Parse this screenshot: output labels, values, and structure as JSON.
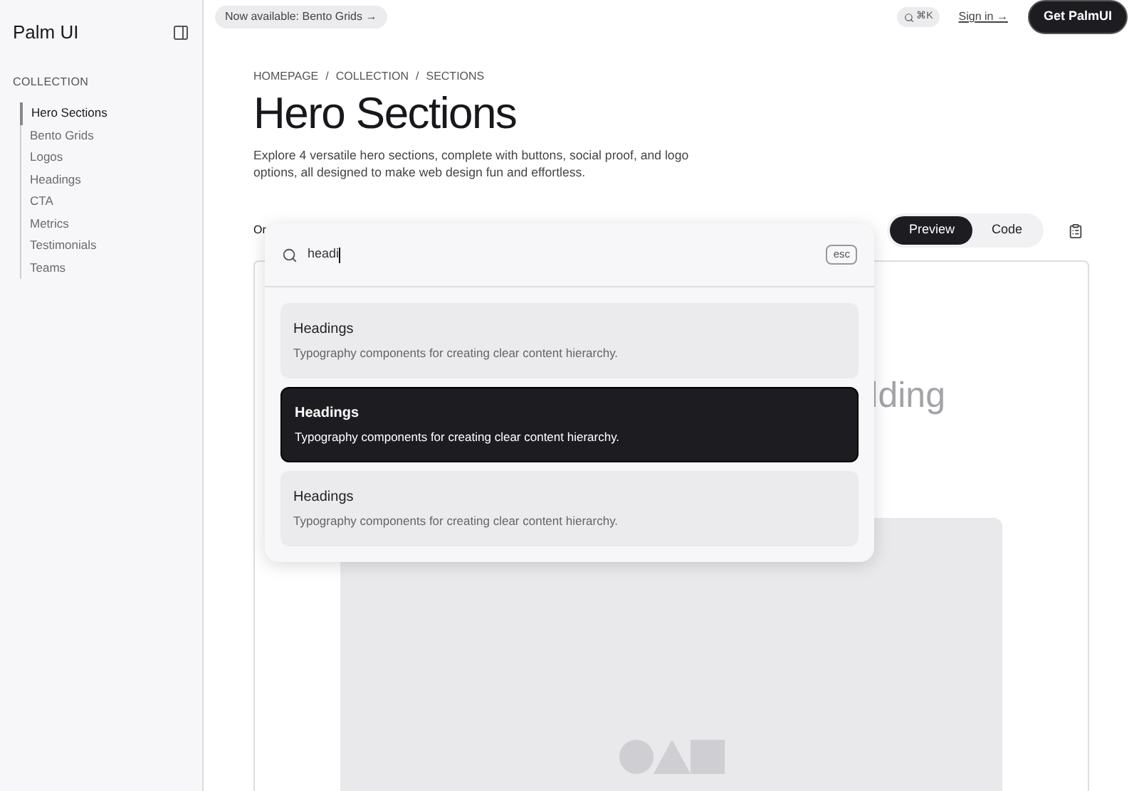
{
  "sidebar": {
    "logo": "Palm UI",
    "section_title": "COLLECTION",
    "items": [
      {
        "label": "Hero Sections",
        "selected": true
      },
      {
        "label": "Bento Grids",
        "selected": false
      },
      {
        "label": "Logos",
        "selected": false
      },
      {
        "label": "Headings",
        "selected": false
      },
      {
        "label": "CTA",
        "selected": false
      },
      {
        "label": "Metrics",
        "selected": false
      },
      {
        "label": "Testimonials",
        "selected": false
      },
      {
        "label": "Teams",
        "selected": false
      }
    ]
  },
  "topbar": {
    "announcement": "Now available: Bento Grids →",
    "search_shortcut": "⌘K",
    "sign_in": "Sign in →",
    "cta": "Get PalmUI"
  },
  "breadcrumb": [
    "HOMEPAGE",
    "COLLECTION",
    "SECTIONS"
  ],
  "breadcrumb_separator": "/",
  "title": "Hero Sections",
  "description": "Explore 4 versatile hero sections, complete with buttons, social proof, and logo options, all designed to make web design fun and effortless.",
  "toolbar": {
    "partial_label": "Or",
    "tabs": [
      {
        "label": "Preview",
        "selected": true
      },
      {
        "label": "Code",
        "selected": false
      }
    ]
  },
  "preview": {
    "partial_heading": "lding"
  },
  "search_dialog": {
    "query": "headi",
    "esc": "esc",
    "results": [
      {
        "title": "Headings",
        "description": "Typography components for creating clear content hierarchy.",
        "selected": false
      },
      {
        "title": "Headings",
        "description": "Typography components for creating clear content hierarchy.",
        "selected": true
      },
      {
        "title": "Headings",
        "description": "Typography components for creating clear content hierarchy.",
        "selected": false
      }
    ]
  }
}
